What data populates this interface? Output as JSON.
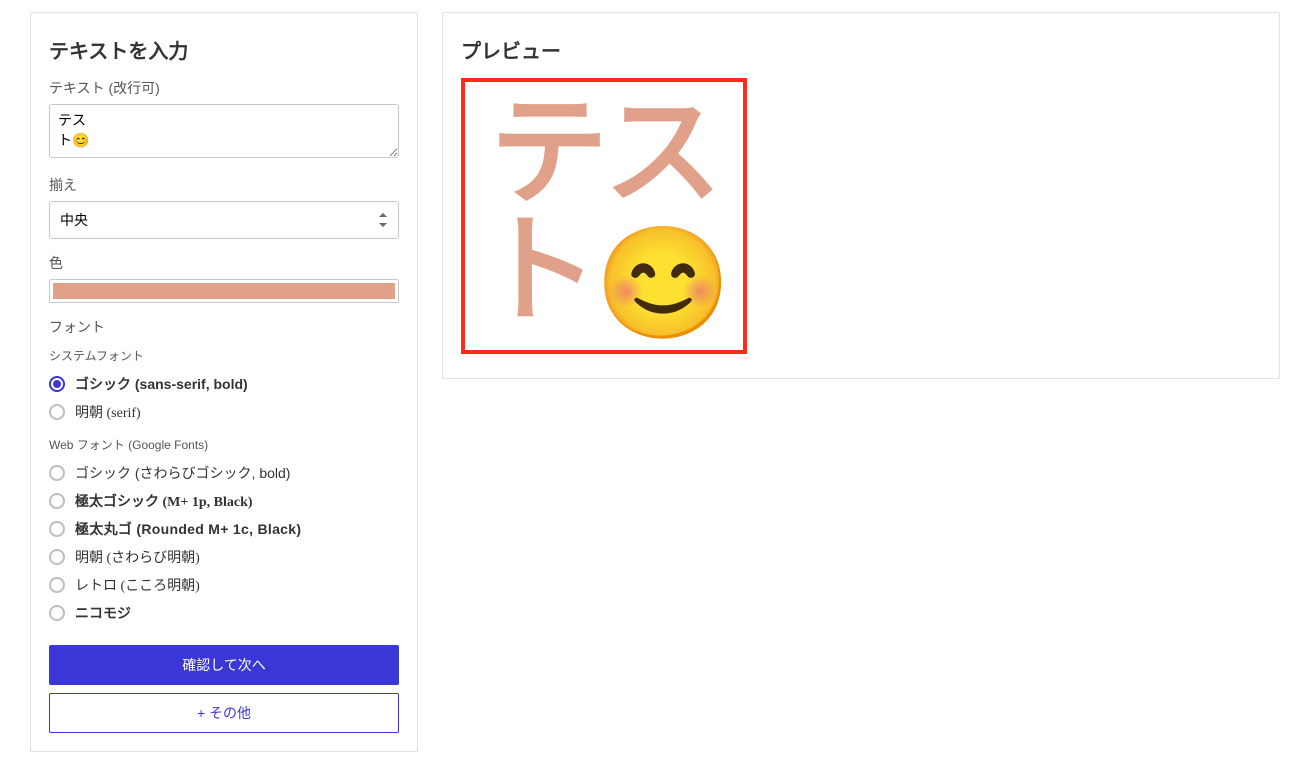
{
  "left": {
    "title": "テキストを入力",
    "text_label": "テキスト (改行可)",
    "text_value": "テス\nト😊",
    "align_label": "揃え",
    "align_value": "中央",
    "color_label": "色",
    "color_value": "#e0a08a",
    "font_label": "フォント",
    "font_groups": {
      "system_label": "システムフォント",
      "web_label": "Web フォント (Google Fonts)"
    },
    "fonts": [
      {
        "id": "gothic-bold",
        "label": "ゴシック (sans-serif, bold)",
        "group": "system",
        "css": "font-gothic-bold",
        "selected": true
      },
      {
        "id": "serif",
        "label": "明朝 (serif)",
        "group": "system",
        "css": "font-serif",
        "selected": false
      },
      {
        "id": "sawarabi-gothic",
        "label": "ゴシック (さわらびゴシック, bold)",
        "group": "web",
        "css": "font-sawarabi-gothic",
        "selected": false
      },
      {
        "id": "mplus-black",
        "label": "極太ゴシック (M+ 1p, Black)",
        "group": "web",
        "css": "font-mplus-black",
        "selected": false
      },
      {
        "id": "rounded-black",
        "label": "極太丸ゴ (Rounded M+ 1c, Black)",
        "group": "web",
        "css": "font-rounded-black",
        "selected": false
      },
      {
        "id": "sawarabi-mincho",
        "label": "明朝 (さわらび明朝)",
        "group": "web",
        "css": "font-sawarabi-mincho",
        "selected": false
      },
      {
        "id": "kokoro",
        "label": "レトロ (こころ明朝)",
        "group": "web",
        "css": "font-retro",
        "selected": false
      },
      {
        "id": "nicomoji",
        "label": "ニコモジ",
        "group": "web",
        "css": "font-nicomoji",
        "selected": false
      }
    ],
    "confirm_label": "確認して次へ",
    "more_label": "+ その他"
  },
  "preview": {
    "title": "プレビュー",
    "line1": "テス",
    "line2_text": "ト",
    "line2_emoji": "😊",
    "border_color": "#ff2a1a",
    "text_color": "#e0a08a"
  }
}
